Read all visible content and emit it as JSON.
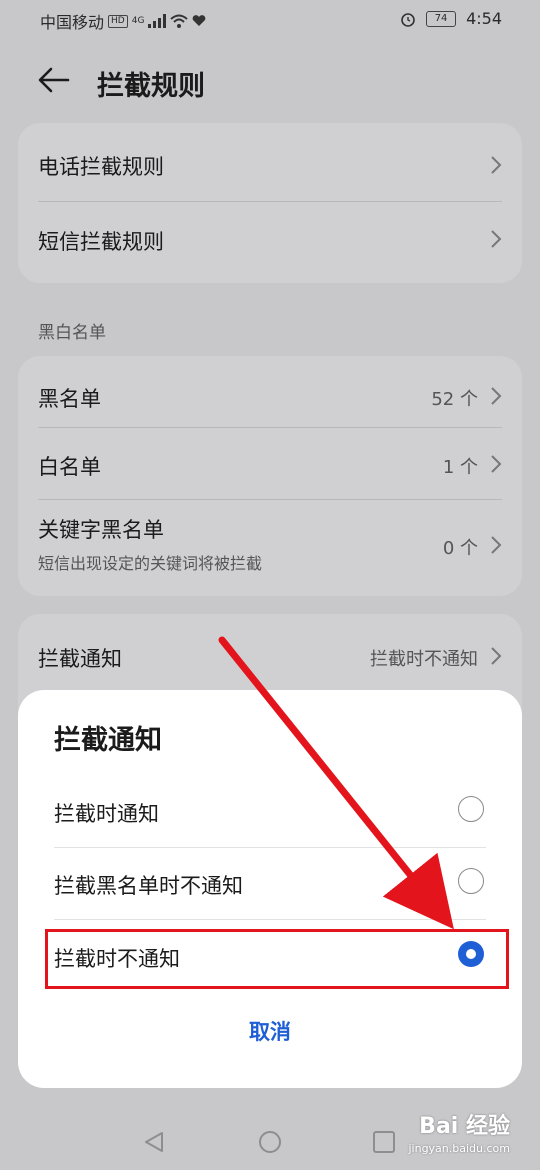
{
  "status": {
    "carrier": "中国移动",
    "hd": "HD",
    "network": "4G",
    "battery": "74",
    "time": "4:54"
  },
  "header": {
    "title": "拦截规则"
  },
  "rules": [
    {
      "label": "电话拦截规则"
    },
    {
      "label": "短信拦截规则"
    }
  ],
  "lists": {
    "section_label": "黑白名单",
    "items": [
      {
        "label": "黑名单",
        "value": "52 个"
      },
      {
        "label": "白名单",
        "value": "1 个"
      },
      {
        "label": "关键字黑名单",
        "sub": "短信出现设定的关键词将被拦截",
        "value": "0 个"
      }
    ]
  },
  "notify": {
    "label": "拦截通知",
    "value": "拦截时不通知"
  },
  "sheet": {
    "title": "拦截通知",
    "options": [
      {
        "label": "拦截时通知",
        "selected": false
      },
      {
        "label": "拦截黑名单时不通知",
        "selected": false
      },
      {
        "label": "拦截时不通知",
        "selected": true
      }
    ],
    "cancel": "取消"
  },
  "watermark": {
    "brand": "Bai 经验",
    "url": "jingyan.baidu.com"
  },
  "colors": {
    "accent": "#1f5fd6",
    "annotation": "#e3141b"
  }
}
